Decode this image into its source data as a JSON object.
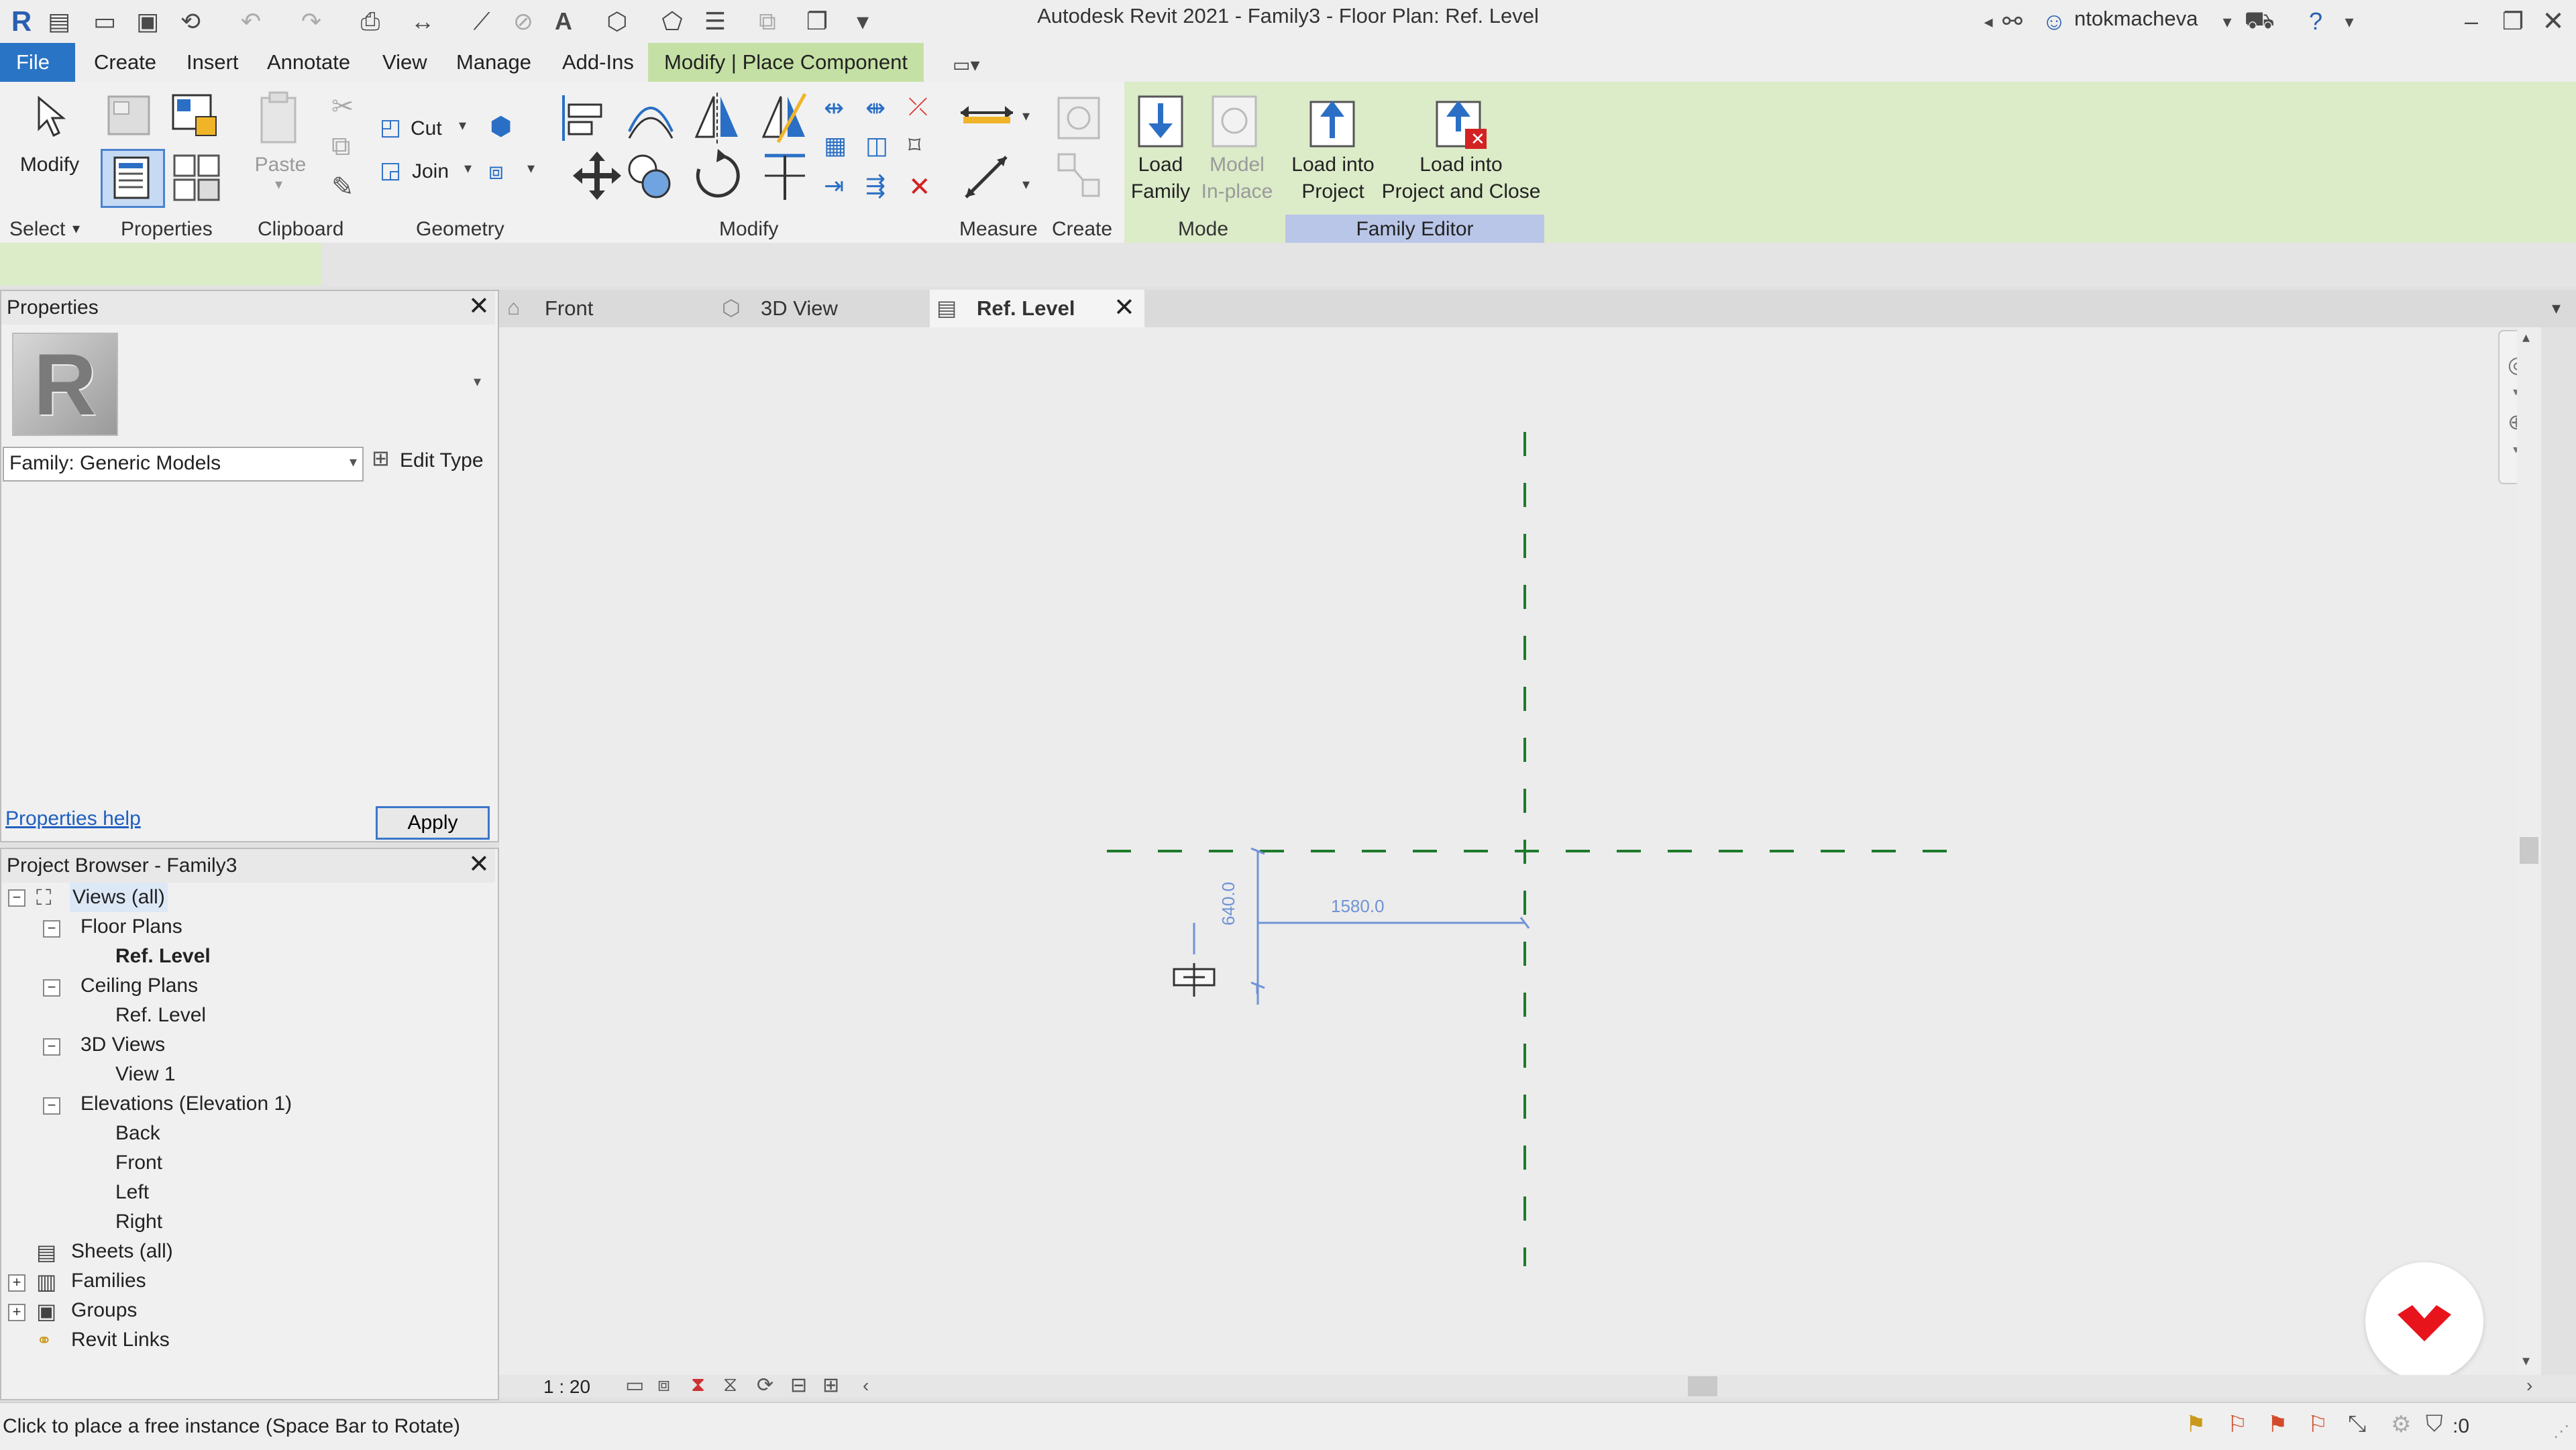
{
  "window": {
    "title": "Autodesk Revit 2021 - Family3 - Floor Plan: Ref. Level",
    "user": "ntokmacheva"
  },
  "menu": {
    "items": [
      "File",
      "Create",
      "Insert",
      "Annotate",
      "View",
      "Manage",
      "Add-Ins",
      "Modify | Place Component"
    ]
  },
  "ribbon": {
    "modify": "Modify",
    "cut": "Cut",
    "join": "Join",
    "paste": "Paste",
    "load_family": [
      "Load",
      "Family"
    ],
    "model_inplace": [
      "Model",
      "In-place"
    ],
    "load_into_project": [
      "Load into",
      "Project"
    ],
    "load_into_project_close": [
      "Load into",
      "Project and Close"
    ],
    "panels": {
      "select": "Select",
      "properties": "Properties",
      "clipboard": "Clipboard",
      "geometry": "Geometry",
      "modify": "Modify",
      "measure": "Measure",
      "create": "Create",
      "mode": "Mode",
      "family_editor": "Family Editor"
    }
  },
  "properties": {
    "title": "Properties",
    "type_selector": "Family: Generic Models",
    "edit_type": "Edit Type",
    "help": "Properties help",
    "apply": "Apply"
  },
  "browser": {
    "title": "Project Browser - Family3",
    "items": [
      {
        "label": "Views (all)",
        "level": 0
      },
      {
        "label": "Floor Plans",
        "level": 1
      },
      {
        "label": "Ref. Level",
        "level": 2,
        "bold": true
      },
      {
        "label": "Ceiling Plans",
        "level": 1
      },
      {
        "label": "Ref. Level",
        "level": 2
      },
      {
        "label": "3D Views",
        "level": 1
      },
      {
        "label": "View 1",
        "level": 2
      },
      {
        "label": "Elevations (Elevation 1)",
        "level": 1
      },
      {
        "label": "Back",
        "level": 2
      },
      {
        "label": "Front",
        "level": 2
      },
      {
        "label": "Left",
        "level": 2
      },
      {
        "label": "Right",
        "level": 2
      },
      {
        "label": "Sheets (all)",
        "level": 0
      },
      {
        "label": "Families",
        "level": 0
      },
      {
        "label": "Groups",
        "level": 0
      },
      {
        "label": "Revit Links",
        "level": 0
      }
    ]
  },
  "tabs": [
    {
      "label": "Front"
    },
    {
      "label": "3D View"
    },
    {
      "label": "Ref. Level",
      "active": true
    }
  ],
  "canvas": {
    "dim_horizontal": "1580.0",
    "dim_vertical": "640.0"
  },
  "viewbar": {
    "scale": "1 : 20"
  },
  "status": {
    "message": "Click to place a free instance (Space Bar to Rotate)",
    "filter_count": ":0"
  },
  "colors": {
    "file_tab": "#2a74c5",
    "context_tab": "#c5e0a5",
    "ref_plane": "#1e7a2a",
    "dimension": "#6f93d6",
    "logo": "#e8141c"
  }
}
